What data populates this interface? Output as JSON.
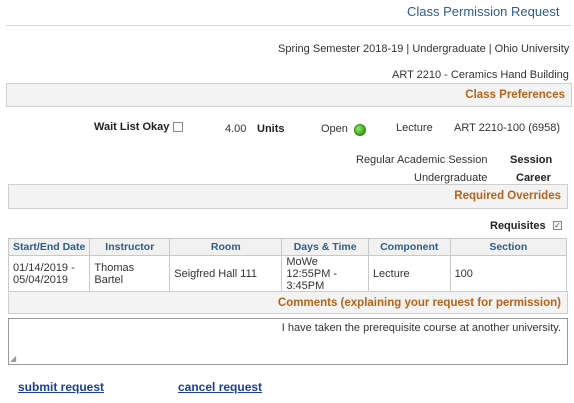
{
  "page": {
    "title": "Class Permission Request",
    "term_line": "Spring Semester 2018-19 | Undergraduate | Ohio University",
    "course_line": "ART 2210 - Ceramics Hand Building"
  },
  "class_preferences": {
    "header": "Class Preferences",
    "class_section": "ART 2210-100 (6958)",
    "component": "Lecture",
    "status": "Open",
    "status_color": "#3aa416",
    "units_label": "Units",
    "units_value": "4.00",
    "wait_list_label": "Wait List Okay",
    "wait_list_checked": false,
    "session_label": "Session",
    "session_value": "Regular Academic Session",
    "career_label": "Career",
    "career_value": "Undergraduate"
  },
  "required_overrides": {
    "header": "Required Overrides",
    "requisites_label": "Requisites",
    "requisites_checked": true
  },
  "sections_table": {
    "headers": [
      "Section",
      "Component",
      "Days & Time",
      "Room",
      "Instructor",
      "Start/End Date"
    ],
    "rows": [
      {
        "section": "100",
        "component": "Lecture",
        "days_time_1": "MoWe 12:55PM -",
        "days_time_2": "3:45PM",
        "room": "Seigfred Hall 111",
        "instructor": "Thomas Bartel",
        "dates_1": "01/14/2019 -",
        "dates_2": "05/04/2019"
      }
    ]
  },
  "comments": {
    "header": "Comments (explaining your request for permission)",
    "value": "I have taken the prerequisite course at another university."
  },
  "actions": {
    "submit_label": "submit request",
    "cancel_label": "cancel request"
  },
  "colors": {
    "section_header_text": "#b5641a",
    "title_text": "#2d5d8b",
    "link": "#1a3e9a"
  }
}
